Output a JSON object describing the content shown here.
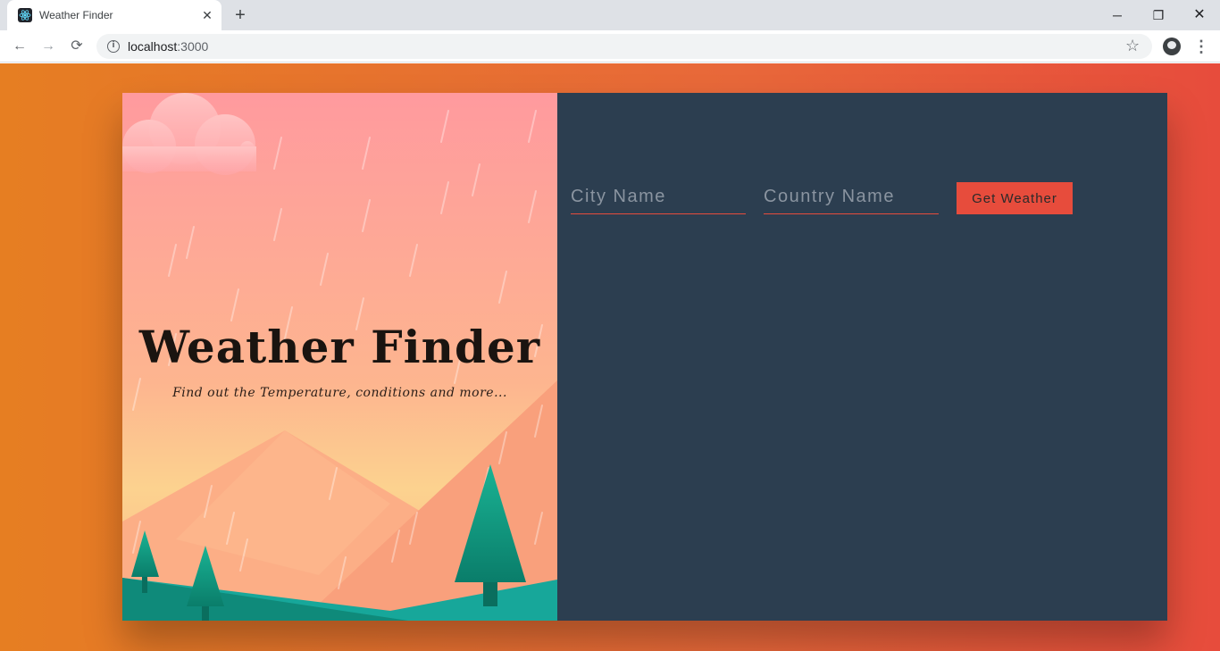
{
  "browser": {
    "tab_title": "Weather Finder",
    "tab_close": "✕",
    "new_tab": "+",
    "url_host": "localhost",
    "url_port": ":3000",
    "window_controls": {
      "minimize": "─",
      "maximize": "❐",
      "close": "✕"
    },
    "nav": {
      "back": "←",
      "forward": "→",
      "reload": "⟳"
    },
    "icons": {
      "info": "i",
      "star": "☆",
      "menu": "⋮"
    }
  },
  "hero": {
    "title": "Weather Finder",
    "subtitle": "Find out the Temperature, conditions and more..."
  },
  "form": {
    "city_placeholder": "City Name",
    "country_placeholder": "Country Name",
    "submit_label": "Get Weather"
  },
  "colors": {
    "page_gradient_start": "#e67e22",
    "page_gradient_end": "#e74c3c",
    "panel_bg": "#2c3e50",
    "accent": "#e74c3c"
  }
}
